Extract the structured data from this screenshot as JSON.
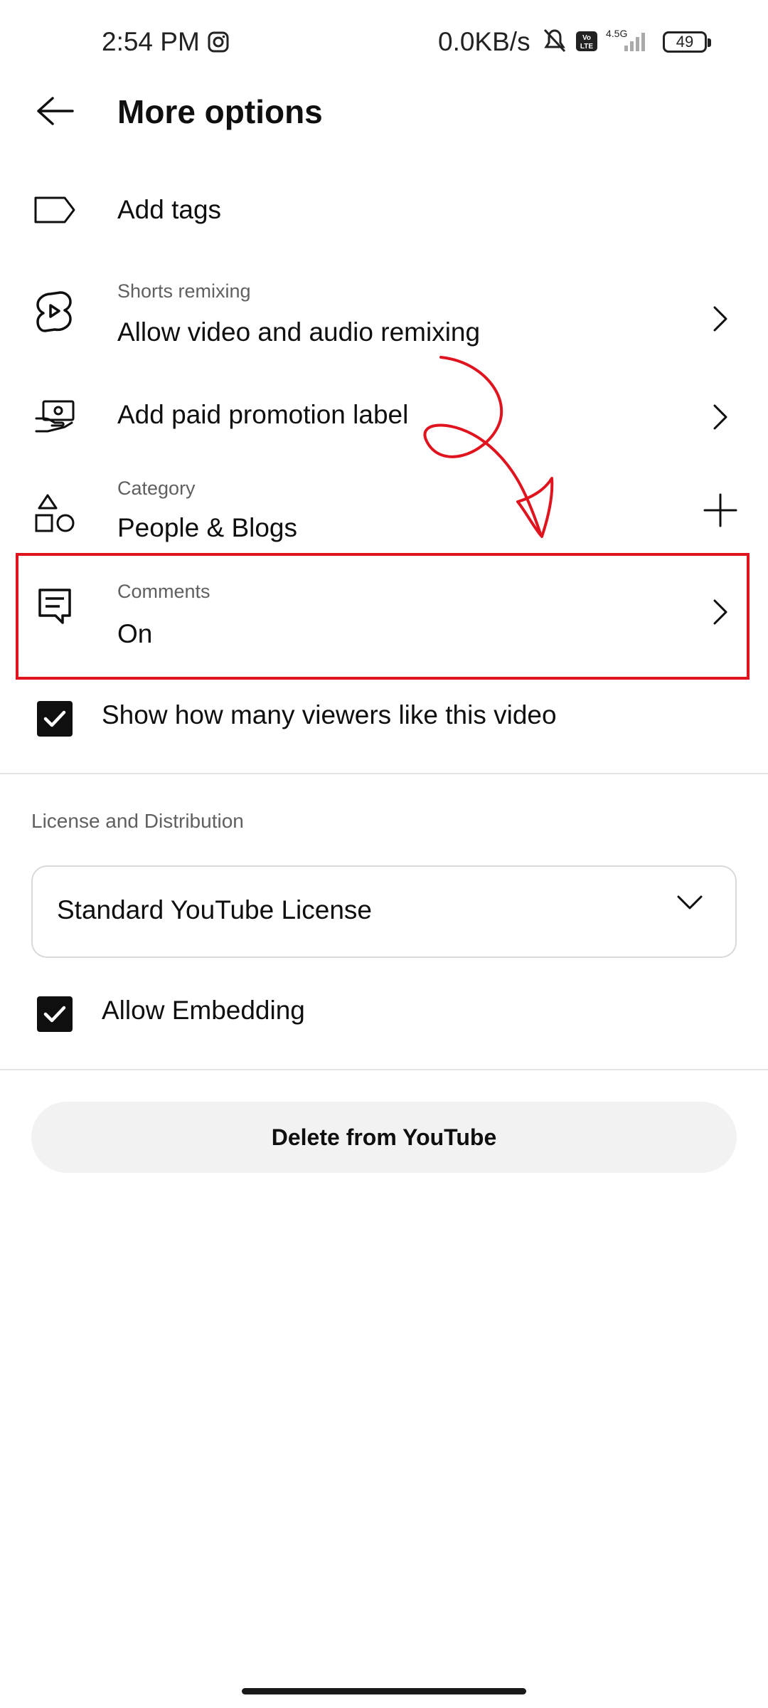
{
  "status_bar": {
    "time": "2:54 PM",
    "network_speed": "0.0KB/s",
    "volte_label": "Vo LTE",
    "network_type": "4.5G",
    "battery": "49"
  },
  "header": {
    "title": "More options"
  },
  "rows": {
    "tags": {
      "label": "Add tags"
    },
    "remixing": {
      "sublabel": "Shorts remixing",
      "label": "Allow video and audio remixing"
    },
    "paid_promo": {
      "label": "Add paid promotion label"
    },
    "category": {
      "sublabel": "Category",
      "label": "People & Blogs"
    },
    "comments": {
      "sublabel": "Comments",
      "label": "On"
    }
  },
  "checkboxes": {
    "show_likes": {
      "label": "Show how many viewers like this video",
      "checked": true
    },
    "allow_embedding": {
      "label": "Allow Embedding",
      "checked": true
    }
  },
  "license": {
    "section_label": "License and Distribution",
    "selected": "Standard YouTube License"
  },
  "actions": {
    "delete_label": "Delete from YouTube"
  },
  "annotation": {
    "color": "#e0141e"
  },
  "icons": {
    "back": "arrow-left-icon",
    "tags": "tag-icon",
    "remixing": "shorts-remix-icon",
    "paid_promo": "paid-promotion-icon",
    "category": "shapes-icon",
    "comments": "comment-icon",
    "chevron": "chevron-right-icon",
    "add": "plus-icon",
    "dropdown": "chevron-down-icon"
  }
}
